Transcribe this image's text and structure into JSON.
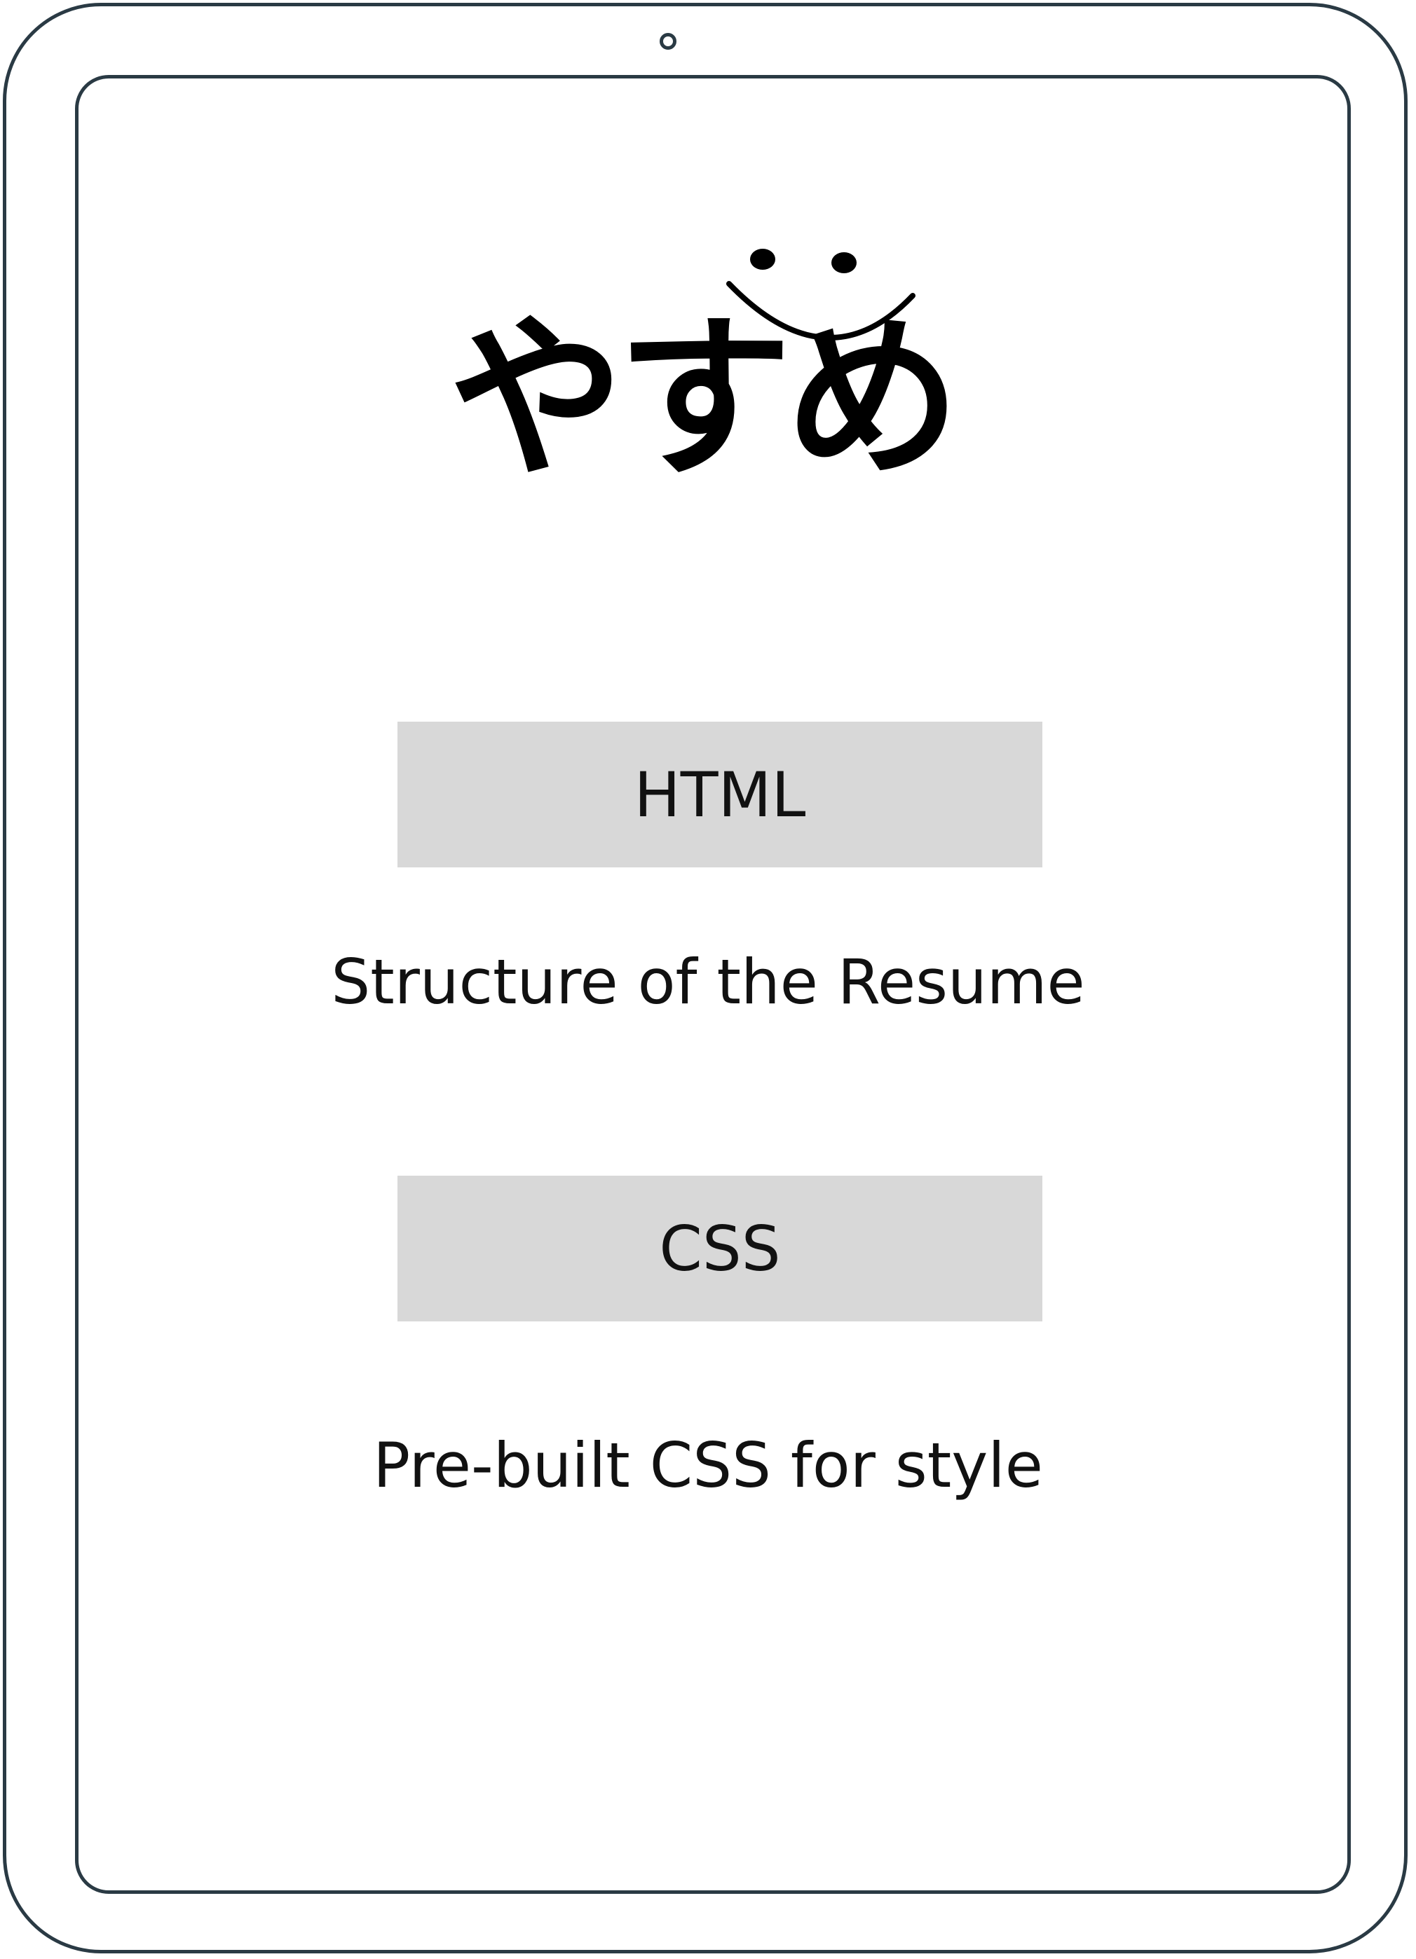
{
  "logo": {
    "text": "やすめ"
  },
  "sections": [
    {
      "label": "HTML",
      "description": "Structure of the Resume"
    },
    {
      "label": "CSS",
      "description": "Pre-built CSS for style"
    }
  ],
  "colors": {
    "frame": "#2a3a44",
    "box": "#d8d8d8",
    "text": "#111111"
  }
}
